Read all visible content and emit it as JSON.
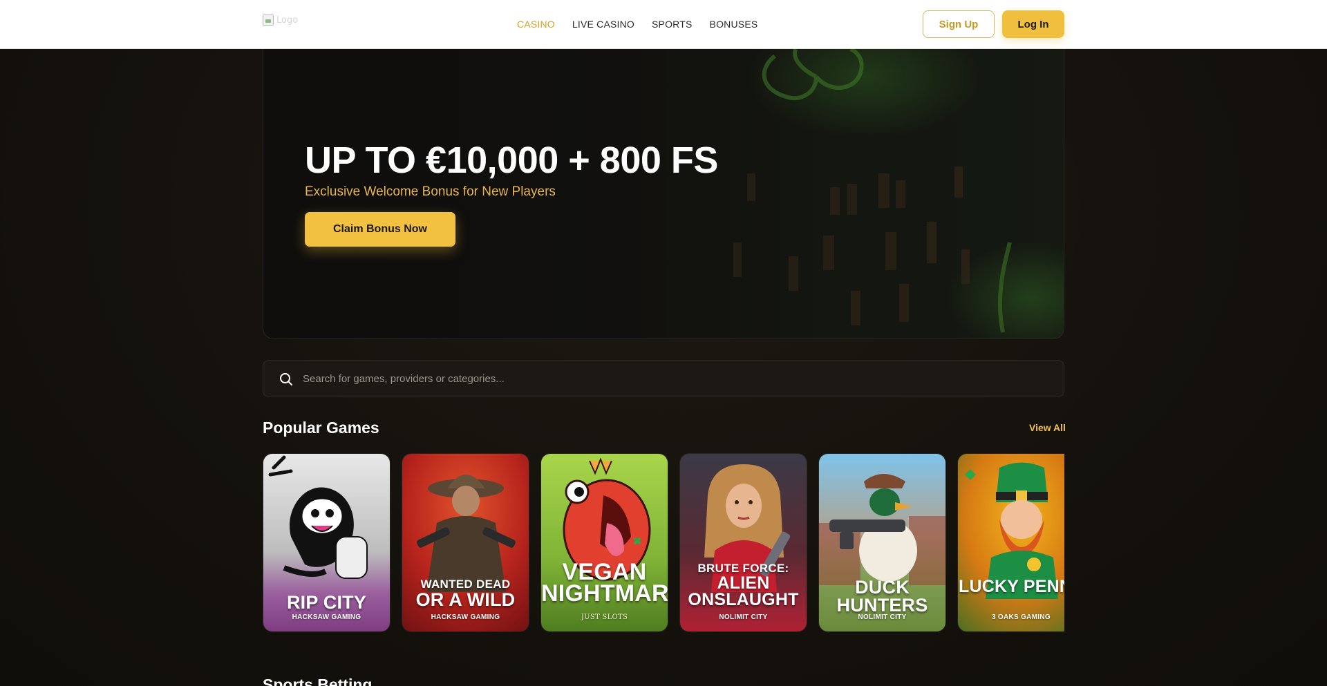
{
  "header": {
    "logo_alt": "Logo",
    "nav": [
      {
        "label": "CASINO",
        "active": true
      },
      {
        "label": "LIVE CASINO",
        "active": false
      },
      {
        "label": "SPORTS",
        "active": false
      },
      {
        "label": "BONUSES",
        "active": false
      }
    ],
    "signup_label": "Sign Up",
    "login_label": "Log In"
  },
  "hero": {
    "title": "UP TO €10,000 + 800 FS",
    "subtitle": "Exclusive Welcome Bonus for New Players",
    "cta_label": "Claim Bonus Now"
  },
  "search": {
    "placeholder": "Search for games, providers or categories..."
  },
  "popular": {
    "title": "Popular Games",
    "view_all": "View All",
    "games": [
      {
        "title_small": "",
        "title_big": "RIP CITY",
        "provider": "HACKSAW GAMING"
      },
      {
        "title_small": "WANTED DEAD",
        "title_big": "OR A WILD",
        "provider": "HACKSAW GAMING"
      },
      {
        "title_small": "",
        "title_big": "VEGAN NIGHTMARE",
        "provider": "JUST SLOTS"
      },
      {
        "title_small": "BRUTE FORCE:",
        "title_big": "ALIEN ONSLAUGHT",
        "provider": "NOLIMIT CITY"
      },
      {
        "title_small": "",
        "title_big": "DUCK HUNTERS",
        "provider": "NOLIMIT CITY"
      },
      {
        "title_small": "",
        "title_big": "LUCKY PENNY",
        "provider": "3 OAKS GAMING"
      }
    ]
  },
  "next_section": {
    "title": "Sports Betting"
  },
  "colors": {
    "accent": "#f2c13f",
    "nav_active": "#d3a125",
    "subtitle": "#e7b64a",
    "background": "#15120d"
  }
}
